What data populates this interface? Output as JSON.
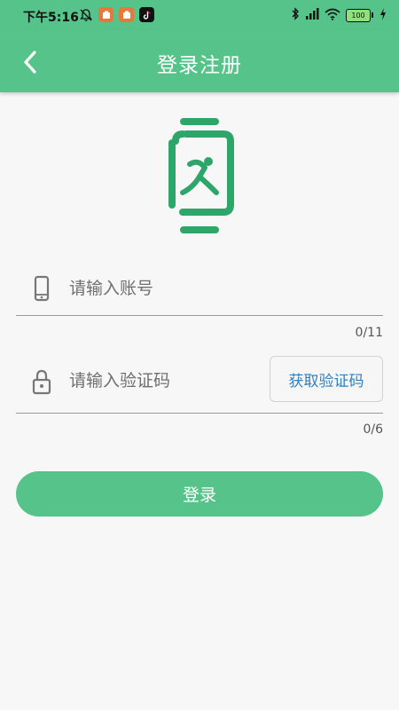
{
  "status_bar": {
    "time": "下午5:16",
    "battery": "100",
    "icons": [
      "mute-bell-icon",
      "app-notification-icon",
      "app-notification-icon",
      "tiktok-icon",
      "bluetooth-icon",
      "signal-icon",
      "wifi-icon",
      "battery-icon",
      "charging-icon"
    ]
  },
  "app_bar": {
    "title": "登录注册",
    "back_icon": "chevron-left-icon"
  },
  "logo": {
    "icon": "smartwatch-runner-logo"
  },
  "account_field": {
    "icon": "phone-icon",
    "placeholder": "请输入账号",
    "value": "",
    "counter": "0/11"
  },
  "code_field": {
    "icon": "lock-icon",
    "placeholder": "请输入验证码",
    "value": "",
    "counter": "0/6",
    "get_code_label": "获取验证码"
  },
  "login_button": {
    "label": "登录"
  },
  "colors": {
    "primary": "#56c48a",
    "background": "#f7f7f7",
    "link": "#2f7fbf"
  }
}
